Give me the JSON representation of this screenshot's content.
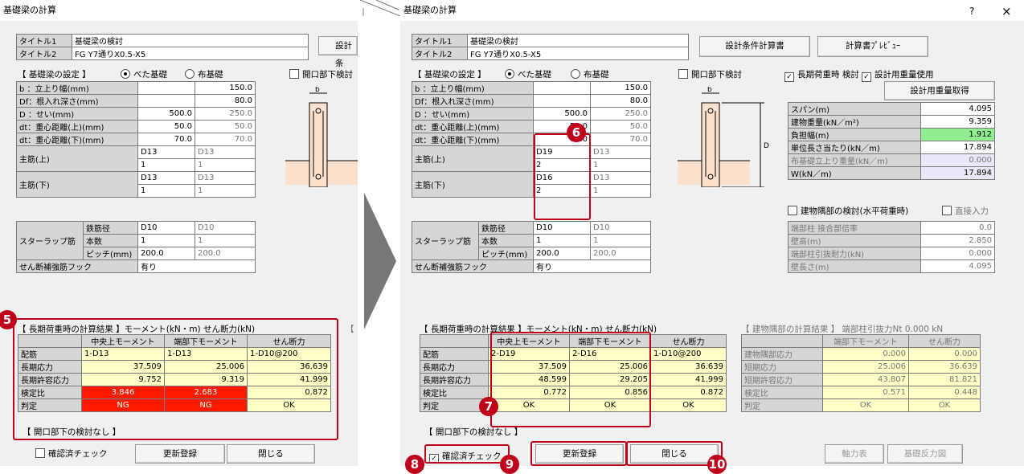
{
  "left": {
    "window_title": "基礎梁の計算",
    "title1_label": "タイトル1",
    "title1_value": "基礎梁の検討",
    "title2_label": "タイトル2",
    "title2_value": "FG Y7通りX0.5-X5",
    "btn_design_partial": "設計条",
    "settings_label": "【 基礎梁の設定 】",
    "radio_beta": "べた基礎",
    "radio_nuno": "布基礎",
    "opening_check": "開口部下検討",
    "params": [
      {
        "label": "b ：立上り幅(mm)",
        "v1": "",
        "v2": "150.0"
      },
      {
        "label": "Df：根入れ深さ(mm)",
        "v1": "",
        "v2": "80.0"
      },
      {
        "label": "D ：せい(mm)",
        "v1": "500.0",
        "v2": "250.0"
      },
      {
        "label": "dt：重心距離(上)(mm)",
        "v1": "50.0",
        "v2": "50.0"
      },
      {
        "label": "dt：重心距離(下)(mm)",
        "v1": "70.0",
        "v2": "70.0"
      }
    ],
    "main_top_label": "主筋(上)",
    "main_top": [
      "D13",
      "D13",
      "1",
      "1"
    ],
    "main_bot_label": "主筋(下)",
    "main_bot": [
      "D13",
      "D13",
      "1",
      "1"
    ],
    "stirrup_label": "スターラップ筋",
    "stirrup_rows": [
      {
        "label": "鉄筋径",
        "v1": "D10",
        "v2": "D10"
      },
      {
        "label": "本数",
        "v1": "1",
        "v2": "1"
      },
      {
        "label": "ピッチ(mm)",
        "v1": "200.0",
        "v2": "200.0"
      }
    ],
    "hook_label": "せん断補強筋フック",
    "hook_value": "有り",
    "result_label": "【 長期荷重時の計算結果 】モーメント(kN・m) せん断力(kN)",
    "result_headers": [
      "",
      "中央上モーメント",
      "端部下モーメント",
      "せん断力"
    ],
    "result_rows": [
      {
        "label": "配筋",
        "c1": "1-D13",
        "c2": "1-D13",
        "c3": "1-D10@200"
      },
      {
        "label": "長期応力",
        "c1": "37.509",
        "c2": "25.006",
        "c3": "36.639"
      },
      {
        "label": "長期許容応力",
        "c1": "9.752",
        "c2": "9.319",
        "c3": "41.999"
      },
      {
        "label": "検定比",
        "c1": "3.846",
        "c2": "2.683",
        "c3": "0.872"
      },
      {
        "label": "判定",
        "c1": "NG",
        "c2": "NG",
        "c3": "OK"
      }
    ],
    "no_opening": "【 開口部下の検討なし 】",
    "confirm_check": "確認済チェック",
    "btn_update": "更新登録",
    "btn_close": "閉じる",
    "badge": "5"
  },
  "right": {
    "window_title": "基礎梁の計算",
    "help_icon": "?",
    "close_icon": "×",
    "title1_label": "タイトル1",
    "title1_value": "基礎梁の検討",
    "title2_label": "タイトル2",
    "title2_value": "FG Y7通りX0.5-X5",
    "btn_design_cond": "設計条件計算書",
    "btn_preview": "計算書ﾌﾟﾚﾋﾞｭｰ",
    "settings_label": "【 基礎梁の設定 】",
    "radio_beta": "べた基礎",
    "radio_nuno": "布基礎",
    "opening_check": "開口部下検討",
    "long_check": "長期荷重時 検討",
    "design_weight": "設計用重量使用",
    "btn_get_weight": "設計用重量取得",
    "params": [
      {
        "label": "b ：立上り幅(mm)",
        "v1": "",
        "v2": "150.0"
      },
      {
        "label": "Df：根入れ深さ(mm)",
        "v1": "",
        "v2": "80.0"
      },
      {
        "label": "D ：せい(mm)",
        "v1": "500.0",
        "v2": "250.0"
      },
      {
        "label": "dt：重心距離(上)(mm)",
        "v1": "50.0",
        "v2": "50.0"
      },
      {
        "label": "dt：重心距離(下)(mm)",
        "v1": "70.0",
        "v2": "70.0"
      }
    ],
    "main_top_label": "主筋(上)",
    "main_top": [
      "D19",
      "D13",
      "2",
      "1"
    ],
    "main_bot_label": "主筋(下)",
    "main_bot": [
      "D16",
      "D13",
      "2",
      "1"
    ],
    "stirrup_label": "スターラップ筋",
    "stirrup_rows": [
      {
        "label": "鉄筋径",
        "v1": "D10",
        "v2": "D10"
      },
      {
        "label": "本数",
        "v1": "1",
        "v2": "1"
      },
      {
        "label": "ピッチ(mm)",
        "v1": "200.0",
        "v2": "200.0"
      }
    ],
    "hook_label": "せん断補強筋フック",
    "hook_value": "有り",
    "span_rows": [
      {
        "label": "スパン(m)",
        "value": "4.095",
        "style": "wt"
      },
      {
        "label": "建物重量(kN／m²)",
        "value": "9.359",
        "style": "wt"
      },
      {
        "label": "負担幅(m)",
        "value": "1.912",
        "style": "gr"
      },
      {
        "label": "単位長さ当たり(kN／m)",
        "value": "17.894",
        "style": "wt"
      },
      {
        "label": "布基礎立上り重量(kN／m)",
        "value": "0.000",
        "style": "lv"
      },
      {
        "label": "W(kN／m)",
        "value": "17.894",
        "style": "lv"
      }
    ],
    "corner_check": "建物隅部の検討(水平荷重時)",
    "direct_input": "直接入力",
    "corner_rows": [
      {
        "label": "端部柱 接合部倍率",
        "value": "0.0"
      },
      {
        "label": "壁高(m)",
        "value": "2.850"
      },
      {
        "label": "端部柱引抜耐力(kN)",
        "value": "0.000"
      },
      {
        "label": "壁長さ(m)",
        "value": "4.095"
      }
    ],
    "result_label": "【 長期荷重時の計算結果 】モーメント(kN・m) せん断力(kN)",
    "result_headers": [
      "",
      "中央上モーメント",
      "端部下モーメント",
      "せん断力"
    ],
    "result_rows": [
      {
        "label": "配筋",
        "c1": "2-D19",
        "c2": "2-D16",
        "c3": "1-D10@200"
      },
      {
        "label": "長期応力",
        "c1": "37.509",
        "c2": "25.006",
        "c3": "36.639"
      },
      {
        "label": "長期許容応力",
        "c1": "48.599",
        "c2": "29.205",
        "c3": "41.999"
      },
      {
        "label": "検定比",
        "c1": "0.772",
        "c2": "0.856",
        "c3": "0.872"
      },
      {
        "label": "判定",
        "c1": "OK",
        "c2": "OK",
        "c3": "OK"
      }
    ],
    "corner_result_label": "【 建物隅部の計算結果 】 端部柱引抜力Nt 0.000 kN",
    "corner_result_headers": [
      "",
      "端部下モーメント",
      "せん断力"
    ],
    "corner_result_rows": [
      {
        "label": "建物隅部応力",
        "c1": "0.000",
        "c2": "0.000"
      },
      {
        "label": "短期応力",
        "c1": "25.006",
        "c2": "36.639"
      },
      {
        "label": "短期許容応力",
        "c1": "43.807",
        "c2": "81.821"
      },
      {
        "label": "検定比",
        "c1": "0.571",
        "c2": "0.448"
      },
      {
        "label": "判定",
        "c1": "OK",
        "c2": "OK"
      }
    ],
    "no_opening": "【 開口部下の検討なし 】",
    "confirm_check": "確認済チェック",
    "btn_update": "更新登録",
    "btn_close": "閉じる",
    "btn_axial": "軸力表",
    "btn_reaction": "基礎反力図",
    "badges": [
      "6",
      "7",
      "8",
      "9",
      "10"
    ]
  },
  "colors": {
    "accent_red": "#c0001a",
    "ng_red": "#ff1a00",
    "result_yellow": "#ffffc8",
    "input_green": "#90ee90"
  }
}
